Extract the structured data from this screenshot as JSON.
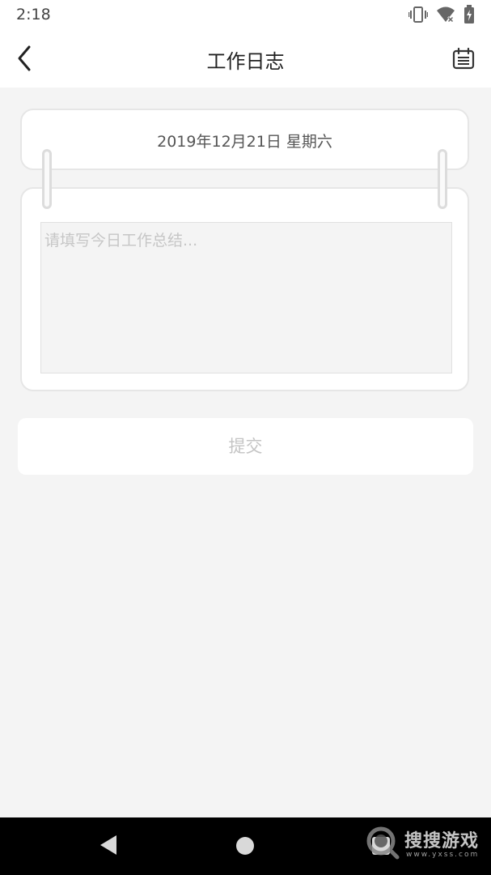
{
  "status_bar": {
    "time": "2:18",
    "icons": [
      "vibrate-icon",
      "wifi-x-icon",
      "battery-charging-icon"
    ]
  },
  "header": {
    "title": "工作日志",
    "back_icon": "chevron-left-icon",
    "right_icon": "calendar-icon"
  },
  "date_card": {
    "date": "2019年12月21日 星期六"
  },
  "summary": {
    "value": "",
    "placeholder": "请填写今日工作总结..."
  },
  "submit": {
    "label": "提交"
  },
  "watermark": {
    "name": "搜搜游戏",
    "url": "www.yxss.com"
  },
  "colors": {
    "background": "#f4f4f4",
    "card": "#ffffff",
    "placeholder": "#c6c6c6",
    "submit_text": "#c4c4c4",
    "navbar": "#000000"
  }
}
